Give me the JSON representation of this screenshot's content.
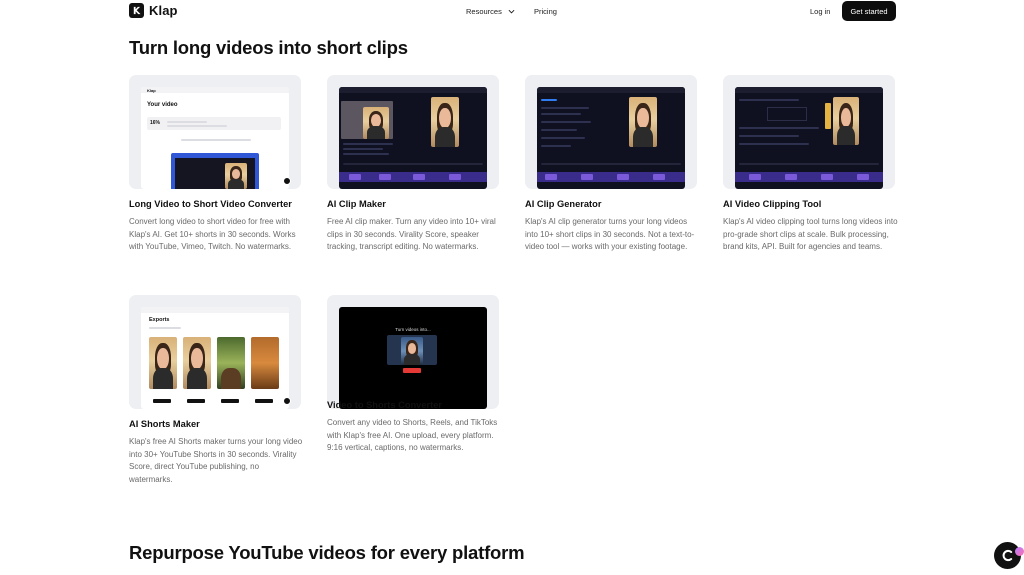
{
  "nav": {
    "logo_text": "Klap",
    "resources_label": "Resources",
    "pricing_label": "Pricing",
    "login_label": "Log in",
    "cta_label": "Get started"
  },
  "section_top": {
    "title": "Turn long videos into short clips"
  },
  "cards": [
    {
      "title": "Long Video to Short Video Converter",
      "description": "Convert long video to short video for free with Klap's AI. Get 10+ shorts in 30 seconds. Works with YouTube, Vimeo, Twitch. No watermarks.",
      "thumb": {
        "brand": "Klap",
        "heading": "Your video",
        "progress": "16%"
      }
    },
    {
      "title": "AI Clip Maker",
      "description": "Free AI clip maker. Turn any video into 10+ viral clips in 30 seconds. Virality Score, speaker tracking, transcript editing. No watermarks."
    },
    {
      "title": "AI Clip Generator",
      "description": "Klap's AI clip generator turns your long videos into 10+ short clips in 30 seconds. Not a text-to-video tool — works with your existing footage."
    },
    {
      "title": "AI Video Clipping Tool",
      "description": "Klap's AI video clipping tool turns long videos into pro-grade short clips at scale. Bulk processing, brand kits, API. Built for agencies and teams."
    },
    {
      "title": "AI Shorts Maker",
      "description": "Klap's free AI Shorts maker turns your long video into 30+ YouTube Shorts in 30 seconds. Virality Score, direct YouTube publishing, no watermarks.",
      "thumb": {
        "heading": "Exports"
      }
    },
    {
      "title": "Video to Shorts Converter",
      "description": "Convert any video to Shorts, Reels, and TikToks with Klap's free AI. One upload, every platform. 9:16 vertical, captions, no watermarks.",
      "thumb": {
        "caption": "Turn videos into..."
      }
    }
  ],
  "section_bottom": {
    "title": "Repurpose YouTube videos for every platform"
  },
  "icons": {
    "logo": "klap-logo-icon",
    "resources_chevron": "chevron-down-icon",
    "chat": "chat-icon"
  },
  "colors": {
    "brand_dark": "#0d0d0d",
    "clip_strip": "#3a2c8a",
    "chat_badge": "#b67bff"
  }
}
